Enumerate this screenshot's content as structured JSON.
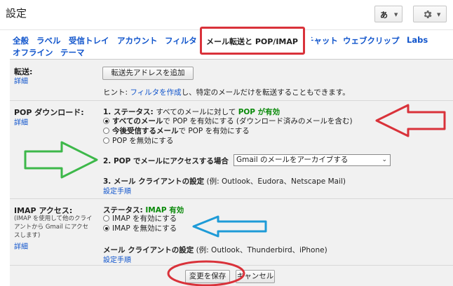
{
  "header": {
    "title": "設定",
    "ime_label": "あ",
    "caret": "▼"
  },
  "tabs": [
    {
      "label": "全般"
    },
    {
      "label": "ラベル"
    },
    {
      "label": "受信トレイ"
    },
    {
      "label": "アカウント"
    },
    {
      "label": "フィルタ"
    },
    {
      "label": "メール転送と POP/IMAP"
    },
    {
      "label": "チャット"
    },
    {
      "label": "ウェブクリップ"
    },
    {
      "label": "Labs"
    },
    {
      "label": "オフライン"
    },
    {
      "label": "テーマ"
    }
  ],
  "forwarding": {
    "label": "転送:",
    "details": "詳細",
    "add_button": "転送先アドレスを追加",
    "hint_prefix": "ヒント: ",
    "hint_link": "フィルタを作成",
    "hint_suffix": "し、特定のメールだけを転送することもできます。"
  },
  "pop": {
    "label": "POP ダウンロード:",
    "details": "詳細",
    "status_heading": "1. ステータス: ",
    "status_text": "すべてのメールに対して ",
    "status_value": "POP が有効",
    "opt_all_bold": "すべてのメール",
    "opt_all_rest": "で POP を有効にする (ダウンロード済みのメールを含む)",
    "opt_new_bold": "今後受信するメール",
    "opt_new_rest": "で POP を有効にする",
    "opt_disable": "POP を無効にする",
    "access_heading": "2. POP でメールにアクセスする場合",
    "access_select": "Gmail のメールをアーカイブする",
    "client_heading": "3. メール クライアントの設定",
    "client_examples": " (例: Outlook、Eudora、Netscape Mail)",
    "setup_link": "設定手順"
  },
  "imap": {
    "label": "IMAP アクセス:",
    "note": "(IMAP を使用して他のクライアントから Gmail にアクセスします)",
    "details": "詳細",
    "status_heading": "ステータス: ",
    "status_value": "IMAP 有効",
    "opt_enable": "IMAP を有効にする",
    "opt_disable": "IMAP を無効にする",
    "client_heading": "メール クライアントの設定",
    "client_examples": " (例: Outlook、Thunderbird、iPhone)",
    "setup_link": "設定手順"
  },
  "footer": {
    "save": "変更を保存",
    "cancel": "キャンセル"
  },
  "colors": {
    "annotation_red": "#d9323a",
    "annotation_green": "#3db84a",
    "annotation_blue": "#1e9bd7",
    "link_blue": "#1155cc",
    "status_green": "#0a8a0a"
  },
  "selected": {
    "pop_option": "all",
    "imap_option": "disable"
  }
}
